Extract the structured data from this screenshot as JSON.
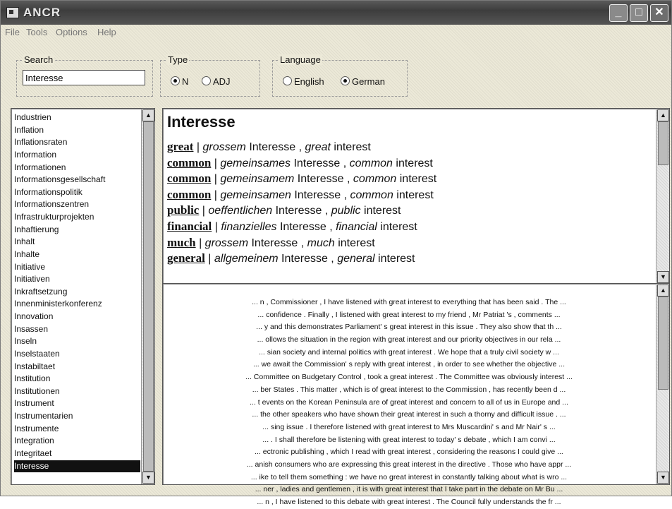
{
  "window": {
    "title": "ANCR"
  },
  "menu": [
    "File",
    "Tools",
    "Options",
    "Help"
  ],
  "search": {
    "label": "Search",
    "value": "Interesse"
  },
  "type": {
    "label": "Type",
    "options": [
      "N",
      "ADJ"
    ],
    "selected": "N"
  },
  "language": {
    "label": "Language",
    "options": [
      "English",
      "German"
    ],
    "selected": "German"
  },
  "wordlist": {
    "items": [
      "Industrien",
      "Inflation",
      "Inflationsraten",
      "Information",
      "Informationen",
      "Informationsgesellschaft",
      "Informationspolitik",
      "Informationszentren",
      "Infrastrukturprojekten",
      "Inhaftierung",
      "Inhalt",
      "Inhalte",
      "Initiative",
      "Initiativen",
      "Inkraftsetzung",
      "Innenministerkonferenz",
      "Innovation",
      "Insassen",
      "Inseln",
      "Inselstaaten",
      "Instabiltaet",
      "Institution",
      "Institutionen",
      "Instrument",
      "Instrumentarien",
      "Instrumente",
      "Integration",
      "Integritaet",
      "Interesse"
    ],
    "selected": "Interesse"
  },
  "entry": {
    "headword": "Interesse",
    "rows": [
      {
        "kw": "great",
        "de": "grossem",
        "en": "great"
      },
      {
        "kw": "common",
        "de": "gemeinsames",
        "en": "common"
      },
      {
        "kw": "common",
        "de": "gemeinsamem",
        "en": "common"
      },
      {
        "kw": "common",
        "de": "gemeinsamen",
        "en": "common"
      },
      {
        "kw": "public",
        "de": "oeffentlichen",
        "en": "public"
      },
      {
        "kw": "financial",
        "de": "finanzielles",
        "en": "financial"
      },
      {
        "kw": "much",
        "de": "grossem",
        "en": "much"
      },
      {
        "kw": "general",
        "de": "allgemeinem",
        "en": "general"
      }
    ],
    "noun_de": "Interesse",
    "noun_en": "interest"
  },
  "concordance": [
    "... n , Commissioner , I have listened with great interest to everything that has been said .  The ...",
    "... confidence .  Finally , I listened with great interest to my friend , Mr Patriat 's , comments ...",
    "... y and this demonstrates Parliament' s great interest in this issue .  They also show that th ...",
    "... ollows the situation in the region with great interest and our priority objectives in our rela ...",
    "... sian society and internal politics with great interest .  We hope that a truly civil society w ...",
    "... we await the Commission' s reply with great interest , in order to see whether the objective ...",
    "... Committee on Budgetary Control , took a great interest .  The Committee was obviously interest ...",
    "... ber States .  This matter , which is of great interest to the Commission , has recently been d ...",
    "... t events on the Korean Peninsula are of great interest and concern to all of us in Europe and ...",
    "... the other speakers who have shown their great interest in such a thorny and difficult issue . ...",
    "... sing issue .  I therefore listened with great interest to Mrs Muscardini' s and Mr Nair' s ...",
    "... .  I shall therefore be listening with great interest to today' s debate , which I am convi ...",
    "... ectronic publishing , which I read with great interest , considering the reasons I could give ...",
    "... anish consumers who are expressing this great interest in the directive .  Those who have appr ...",
    "... ike to tell them something : we have no great interest in constantly talking about what is wro ...",
    "... ner , ladies and gentlemen , it is with great interest that I take part in the debate on Mr Bu ...",
    "... n , I have listened to this debate with great interest .  The Council fully understands the fr ..."
  ]
}
